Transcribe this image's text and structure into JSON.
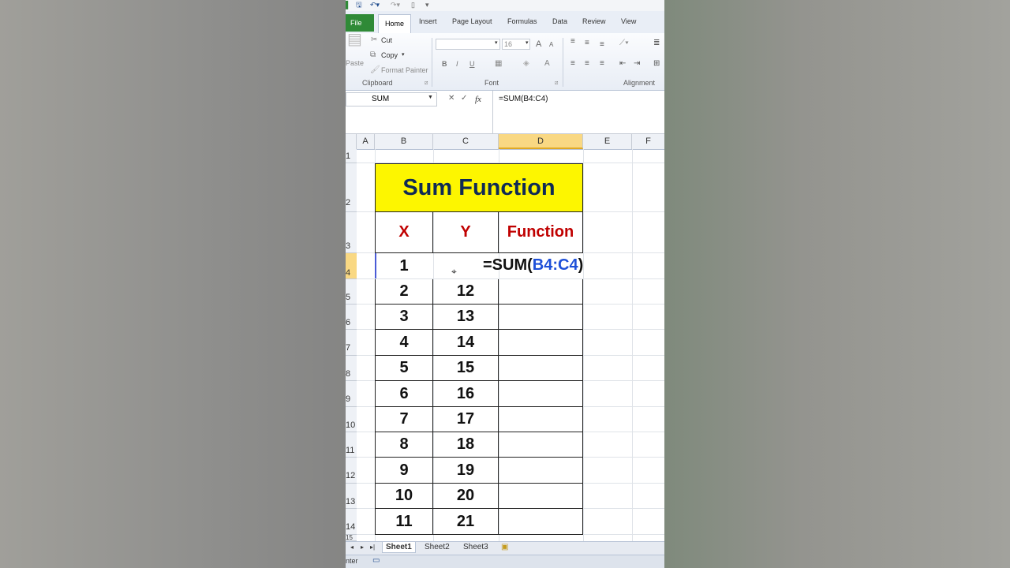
{
  "qat": {
    "save_icon": "save-icon",
    "undo_icon": "undo-icon",
    "redo_icon": "redo-icon"
  },
  "tabs": [
    "File",
    "Home",
    "Insert",
    "Page Layout",
    "Formulas",
    "Data",
    "Review",
    "View"
  ],
  "ribbon": {
    "clipboard": {
      "paste": "Paste",
      "cut": "Cut",
      "copy": "Copy",
      "format_painter": "Format Painter",
      "group": "Clipboard"
    },
    "font": {
      "size": "16",
      "bold": "B",
      "italic": "I",
      "underline": "U",
      "grow": "A",
      "shrink": "A",
      "font_color": "A",
      "group": "Font"
    },
    "alignment": {
      "group": "Alignment"
    }
  },
  "formula_bar": {
    "name_box": "SUM",
    "fx": "fx",
    "formula": "=SUM(B4:C4)"
  },
  "columns": [
    "A",
    "B",
    "C",
    "D",
    "E",
    "F"
  ],
  "rows": [
    "1",
    "2",
    "3",
    "4",
    "5",
    "6",
    "7",
    "8",
    "9",
    "10",
    "11",
    "12",
    "13",
    "14",
    "15"
  ],
  "sheet": {
    "title": "Sum Function",
    "headers": {
      "x": "X",
      "y": "Y",
      "fn": "Function"
    },
    "editing": {
      "x": "1",
      "formula_prefix": "=SUM(",
      "formula_ref": "B4:C4",
      "formula_suffix": ")"
    },
    "data": [
      {
        "x": "2",
        "y": "12"
      },
      {
        "x": "3",
        "y": "13"
      },
      {
        "x": "4",
        "y": "14"
      },
      {
        "x": "5",
        "y": "15"
      },
      {
        "x": "6",
        "y": "16"
      },
      {
        "x": "7",
        "y": "17"
      },
      {
        "x": "8",
        "y": "18"
      },
      {
        "x": "9",
        "y": "19"
      },
      {
        "x": "10",
        "y": "20"
      },
      {
        "x": "11",
        "y": "21"
      }
    ]
  },
  "sheet_tabs": [
    "Sheet1",
    "Sheet2",
    "Sheet3"
  ],
  "status": {
    "mode": "nter"
  }
}
